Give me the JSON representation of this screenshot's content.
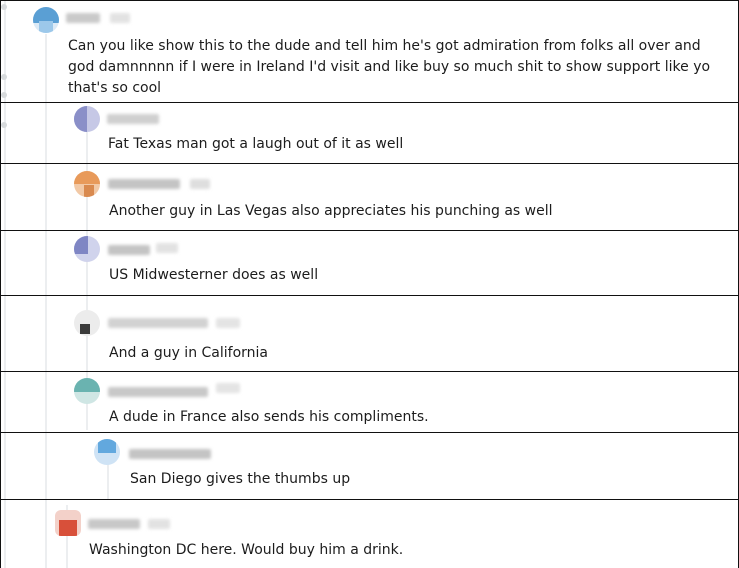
{
  "comments": [
    {
      "text": "Can you like show this to the dude and tell him he's got admiration from folks all over and god damnnnnn if I were in Ireland I'd visit and like buy so much shit to show support like yo that's so cool",
      "avatar_color": "#5a9fd4"
    },
    {
      "text": "Fat Texas man got a laugh out of it as well",
      "avatar_color": "#8a8fc8"
    },
    {
      "text": "Another guy in Las Vegas also appreciates his punching as well",
      "avatar_color": "#e89a5a"
    },
    {
      "text": "US Midwesterner does as well",
      "avatar_color": "#7f86c4"
    },
    {
      "text": "And a guy in California",
      "avatar_color": "#3b3b3b"
    },
    {
      "text": "A dude in France also sends his compliments.",
      "avatar_color": "#6ab3b0"
    },
    {
      "text": "San Diego gives the thumbs up",
      "avatar_color": "#62a8de"
    },
    {
      "text": "Washington DC here. Would buy him a drink.",
      "avatar_color": "#d8503a"
    }
  ]
}
